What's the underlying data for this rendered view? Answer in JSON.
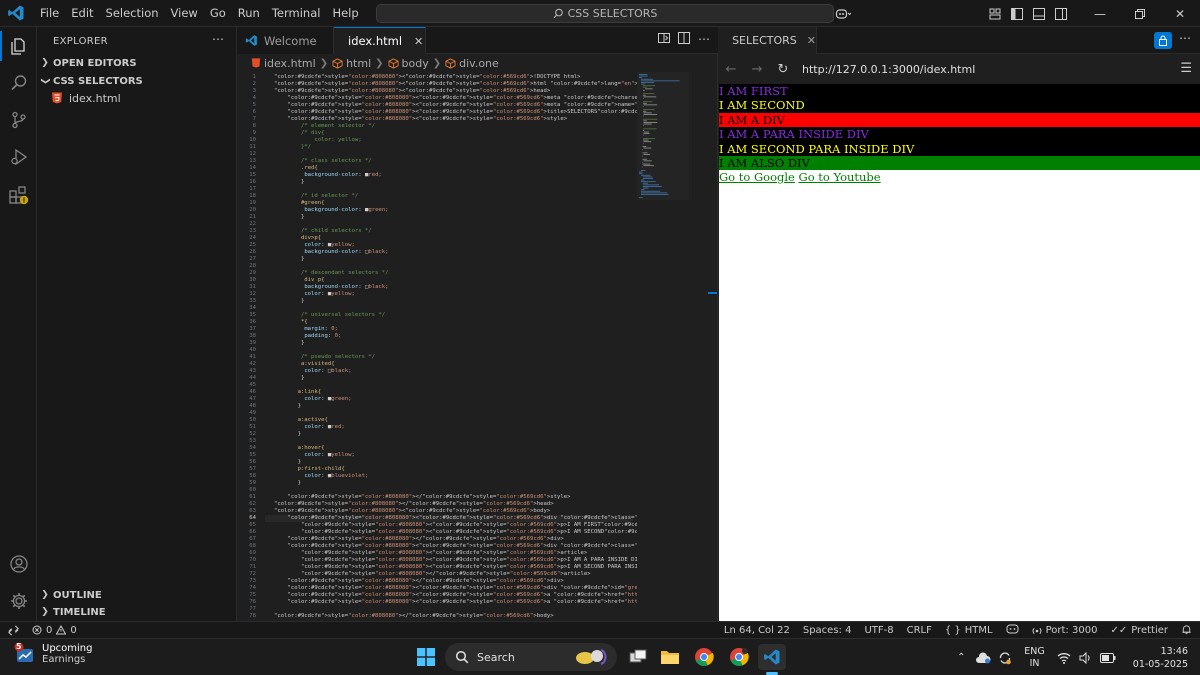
{
  "titlebar": {
    "menus": [
      "File",
      "Edit",
      "Selection",
      "View",
      "Go",
      "Run",
      "Terminal",
      "Help"
    ],
    "command_center": "CSS SELECTORS"
  },
  "sidebar": {
    "title": "EXPLORER",
    "open_editors": "OPEN EDITORS",
    "folder": "CSS SELECTORS",
    "file": "idex.html",
    "outline": "OUTLINE",
    "timeline": "TIMELINE"
  },
  "editor": {
    "tabs": [
      {
        "label": "Welcome",
        "active": false
      },
      {
        "label": "idex.html",
        "active": true
      }
    ],
    "breadcrumb": [
      "idex.html",
      "html",
      "body",
      "div.one"
    ],
    "current_line": 64,
    "lines": [
      "<!DOCTYPE html>",
      "<html lang=\"en\">",
      "<head>",
      "    <meta charset=\"UTF-8\">",
      "    <meta name=\"viewport\" content=\"width=device-width, initial-scale=1.0\">",
      "    <title>SELECTORS</title>",
      "    <style>",
      "        /* element selector */",
      "        /* div{",
      "            color: yellow;",
      "        }*/",
      "",
      "        /* class selectors */",
      "        .red{",
      "         background-color: ■red;",
      "        }",
      "",
      "        /* id selector */",
      "        #green{",
      "         background-color: ■green;",
      "        }",
      "",
      "        /* child selectors */",
      "        div>p{",
      "         color: ■yellow;",
      "         background-color: □black;",
      "        }",
      "",
      "        /* descendant selectors */",
      "         div p{",
      "         background-color: □black;",
      "         color: ■yellow;",
      "        }",
      "",
      "        /* universal selectors */",
      "        *{",
      "         margin: 0;",
      "         padding: 0;",
      "        }",
      "",
      "        /* pseudo selectors */",
      "        a:visited{",
      "         color: □black;",
      "        }",
      "",
      "       a:link{",
      "         color: ■green;",
      "       }",
      "",
      "       a:active{",
      "         color: ■red;",
      "       }",
      "",
      "       a:hover{",
      "         color: ■yellow;",
      "       }",
      "       p:first-child{",
      "         color: ■blueviolet;",
      "       }",
      "",
      "    </style>",
      "</head>",
      "<body>",
      "    <div class=\"one\">",
      "        <p>I AM FIRST</p>",
      "        <p>I AM SECOND</p>",
      "    </div>",
      "    <div class=\"red\">I AM A DIV",
      "        <article>",
      "        <p>I AM A PARA INSIDE DIV</p>",
      "        <p>I AM SECOND PARA INSIDE DIV</p>",
      "        </article>",
      "    </div>",
      "    <div id=\"green\">I AM ALSO DIV</div>",
      "    <a href=\"http://www.google.com\">Go to Google</a>",
      "    <a href=\"http://www.youtube.com\">Go to Youtube</a>",
      "",
      "</body>"
    ]
  },
  "browser": {
    "tab_label": "SELECTORS",
    "url": "http://127.0.0.1:3000/idex.html",
    "page": {
      "lines": [
        {
          "text": "I AM FIRST",
          "color": "#8a2be2",
          "bg": "#000000"
        },
        {
          "text": "I AM SECOND",
          "color": "#ffff00",
          "bg": "#000000"
        },
        {
          "text": "I AM A DIV",
          "color": "#000000",
          "bg": "#ff0000"
        },
        {
          "text": "I AM A PARA INSIDE DIV",
          "color": "#8a2be2",
          "bg": "#000000"
        },
        {
          "text": "I AM SECOND PARA INSIDE DIV",
          "color": "#ffff00",
          "bg": "#000000"
        },
        {
          "text": "I AM ALSO DIV",
          "color": "#000000",
          "bg": "#008000"
        }
      ],
      "links": [
        "Go to Google",
        "Go to Youtube"
      ],
      "link_color": "#008000"
    }
  },
  "statusbar": {
    "errors": "0",
    "warnings": "0",
    "position": "Ln 64, Col 22",
    "spaces": "Spaces: 4",
    "encoding": "UTF-8",
    "eol": "CRLF",
    "language": "HTML",
    "port": "Port: 3000",
    "prettier": "Prettier"
  },
  "taskbar": {
    "weather_badge": "5",
    "weather_title": "Upcoming",
    "weather_sub": "Earnings",
    "search": "Search",
    "lang_top": "ENG",
    "lang_bottom": "IN",
    "time": "13:46",
    "date": "01-05-2025"
  },
  "colors": {
    "accent": "#0078d4",
    "html_icon": "#e44d26",
    "folder_orange": "#e8ab53",
    "breadcrumb_icon": "#e37933"
  }
}
